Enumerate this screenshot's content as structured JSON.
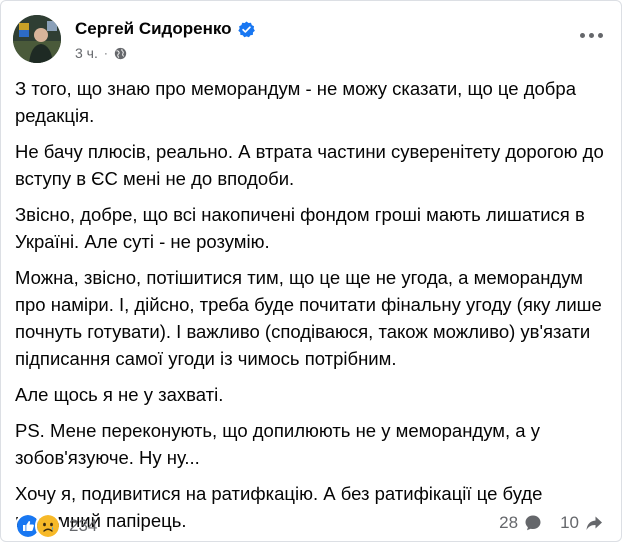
{
  "post": {
    "author": "Сергей Сидоренко",
    "time": "3 ч.",
    "separator": "·",
    "paragraphs": [
      "З того, що знаю про меморандум - не можу сказати, що це добра редакція.",
      "Не бачу плюсів, реально. А втрата частини суверенітету дорогою до вступу в ЄС мені не до вподоби.",
      "Звісно, добре, що всі накопичені фондом гроші мають лишатися в Україні. Але суті - не розумію.",
      "Можна, звісно, потішитися тим, що це ще не угода, а меморандум про наміри. І, дійсно, треба буде почитати фінальну угоду (яку лише почнуть готувати). І важливо (сподіваюся, також можливо) ув'язати підписання самої угоди із чимось потрібним.",
      "Але щось я не у захваті.",
      "PS. Мене переконують, що допилюють не у меморандум, а у зобов'язуюче. Ну ну...",
      "Хочу я, подивитися на ратифкацію. А без ратифікації це буде нікчемний папірець."
    ]
  },
  "footer": {
    "reaction_count": "234",
    "comment_count": "28",
    "share_count": "10"
  },
  "icons": {
    "verified": "verified-badge-icon",
    "audience": "globe-icon",
    "more": "more-options-icon",
    "like": "like-reaction-icon",
    "sad": "sad-reaction-icon",
    "comment": "comment-icon",
    "share": "share-icon"
  },
  "colors": {
    "verified_blue": "#1877f2",
    "like_blue": "#1877f2",
    "sad_yellow": "#f7b928",
    "secondary_text": "#65676b"
  }
}
